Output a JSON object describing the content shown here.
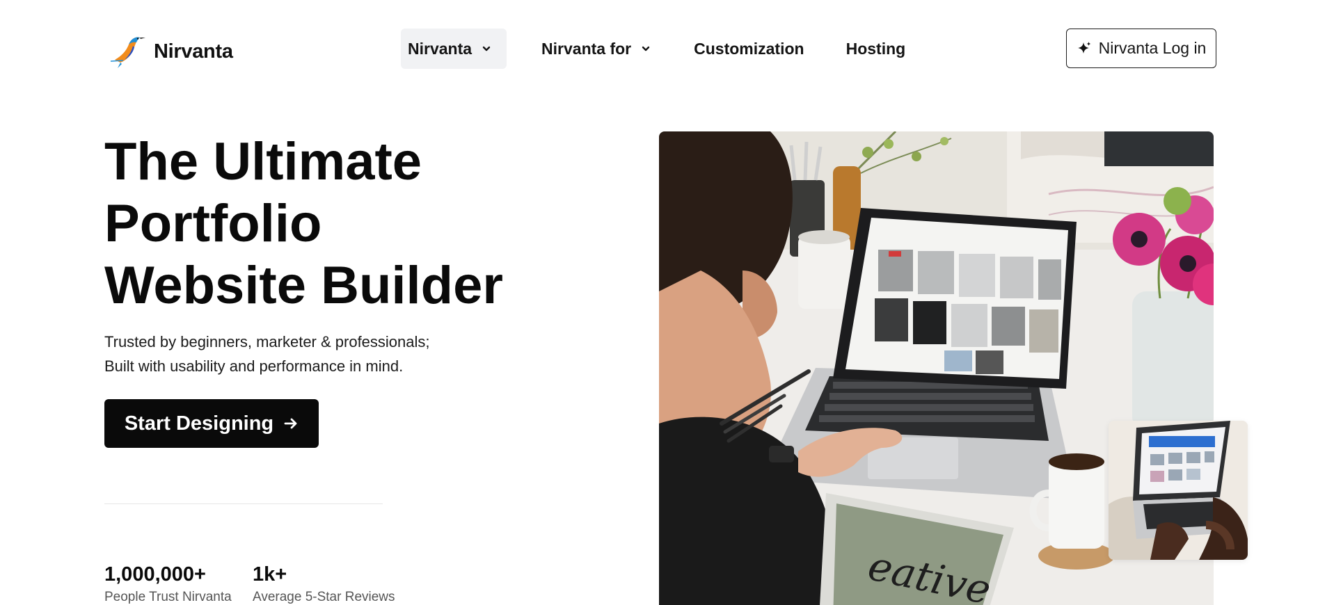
{
  "brand": {
    "name": "Nirvanta",
    "logo_icon": "kingfisher-bird-logo"
  },
  "nav": {
    "items": [
      {
        "label": "Nirvanta",
        "has_dropdown": true,
        "active": true
      },
      {
        "label": "Nirvanta for",
        "has_dropdown": true,
        "active": false
      },
      {
        "label": "Customization",
        "has_dropdown": false,
        "active": false
      },
      {
        "label": "Hosting",
        "has_dropdown": false,
        "active": false
      }
    ]
  },
  "login": {
    "label": "Nirvanta Log in",
    "icon": "sparkle-icon"
  },
  "hero": {
    "title_lines": [
      "The Ultimate",
      "Portfolio",
      "Website Builder"
    ],
    "subtitle_lines": [
      "Trusted by beginners, marketer & professionals;",
      "Built with usability and performance in mind."
    ],
    "cta_label": "Start Designing",
    "cta_icon": "arrow-right-icon"
  },
  "stats": [
    {
      "value": "1,000,000+",
      "label": "People Trust Nirvanta"
    },
    {
      "value": "1k+",
      "label": "Average 5-Star Reviews"
    }
  ],
  "colors": {
    "text": "#0a0a0a",
    "cta_bg": "#0a0a0a",
    "cta_text": "#ffffff",
    "active_nav_bg": "#f1f2f4",
    "muted_text": "#555555"
  }
}
